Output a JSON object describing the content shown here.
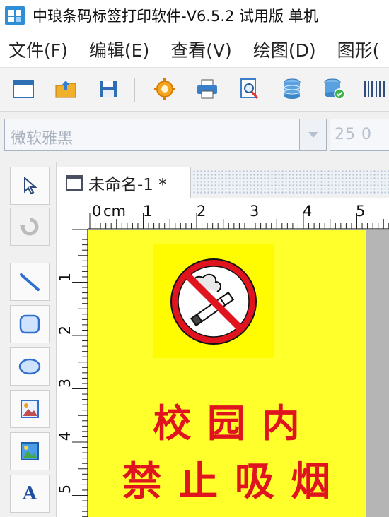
{
  "window": {
    "title": "中琅条码标签打印软件-V6.5.2 试用版 单机"
  },
  "menu": {
    "items": [
      {
        "label": "文件(F)"
      },
      {
        "label": "编辑(E)"
      },
      {
        "label": "查看(V)"
      },
      {
        "label": "绘图(D)"
      },
      {
        "label": "图形("
      }
    ]
  },
  "toolbar": {
    "icons": [
      "new-document-icon",
      "open-folder-icon",
      "save-icon",
      "settings-gear-icon",
      "print-icon",
      "print-preview-icon",
      "database-icon",
      "database-settings-icon",
      "barcode-icon"
    ]
  },
  "font": {
    "name": "微软雅黑",
    "size": "25 0"
  },
  "palette": {
    "tools": [
      "select-arrow-icon",
      "rotate-icon",
      "line-tool-icon",
      "rounded-rectangle-tool-icon",
      "ellipse-tool-icon",
      "image-tool-icon",
      "picture-tool-icon",
      "text-tool-icon"
    ],
    "text_tool_label": "A"
  },
  "document": {
    "tab_title": "未命名-1 *"
  },
  "ruler": {
    "unit": "cm",
    "h_labels": [
      "0",
      "1",
      "2",
      "3",
      "4",
      "5"
    ],
    "v_labels": [
      "1",
      "2",
      "3",
      "4",
      "5"
    ]
  },
  "label": {
    "line1": "校 园 内",
    "line2": "禁 止 吸 烟",
    "background": "#ffff2b",
    "text_color": "#e0141e"
  }
}
